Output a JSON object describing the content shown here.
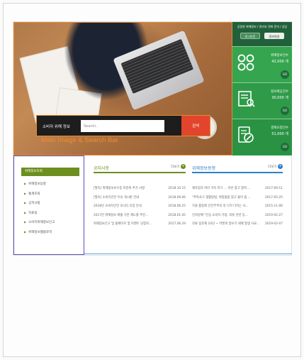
{
  "hero": {
    "search_title": "소비자 위해 정보",
    "search_placeholder": "Search..",
    "search_button": "검색",
    "annotation": "Main Image & Search Bar"
  },
  "stats_panel": {
    "title": "공정한 위해정보 / 관리자 전화 문의 / 상담",
    "buttons": [
      "로그아웃",
      "정보변경"
    ],
    "items": [
      {
        "label": "위해정보건수",
        "value": "42,000 개",
        "go": "GO",
        "icon": "chain-rings-icon"
      },
      {
        "label": "정보제공건수",
        "value": "30,000 개",
        "go": "GO",
        "icon": "report-icon"
      },
      {
        "label": "결제요청건수",
        "value": "51,000 개",
        "go": "GO",
        "icon": "document-pen-icon"
      }
    ]
  },
  "left_nav": {
    "header": "위해정보조회",
    "items": [
      "위해정보동향",
      "통계조회",
      "공지사항",
      "자료실",
      "소비자위해정보신고",
      "위해정보웹블로역"
    ]
  },
  "notices": {
    "title": "공지사항",
    "more": "더보기",
    "rows": [
      {
        "text": "[필독] 위해정보보수증 미분류 추가 사항",
        "date": "2018.10.15"
      },
      {
        "text": "[필독] 소비자안전 이슈 게시판 안내",
        "date": "2018.09.06"
      },
      {
        "text": "2018년 소비자안전 모니터 모집 안내",
        "date": "2018.06.25"
      },
      {
        "text": "2017년 위해정보 제출 기관 제도를 추진...",
        "date": "2018.01.05"
      },
      {
        "text": "위해정보신고 및 홈페이지 및 이벤트 당첨자...",
        "date": "2017.06.29"
      }
    ]
  },
  "trends": {
    "title": "위해정보동향",
    "more": "더보기",
    "rows": [
      {
        "text": "제조업자 여러 가지 마크 ... 이런 참고 참여 ...",
        "date": "2017-09-11"
      },
      {
        "text": "\"추락사고 생활방법, 위험물품 접고 물어 줌 ...",
        "date": "2017-05-25"
      },
      {
        "text": "가을 활동에 안전부주의 의 다치 다치는 사...",
        "date": "2015-11-06"
      },
      {
        "text": "전자담배 \"안심 소비자 가정, 의류 관련 등...",
        "date": "2019-02-27"
      },
      {
        "text": "의류 섬유제 10년 ~ 어떻게 알쓰기 세제 발생 사요...",
        "date": "2019-02-07"
      }
    ]
  }
}
